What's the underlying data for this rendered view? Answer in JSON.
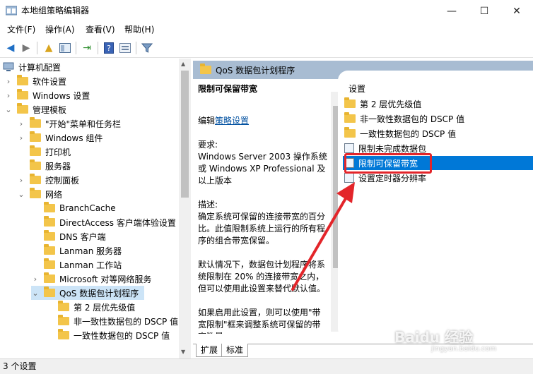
{
  "window": {
    "title": "本地组策略编辑器",
    "minimize_icon": "minimize-icon",
    "maximize_icon": "maximize-icon",
    "close_icon": "close-icon"
  },
  "menu": [
    "文件(F)",
    "操作(A)",
    "查看(V)",
    "帮助(H)"
  ],
  "toolbar": {
    "icons": [
      "back-arrow-icon",
      "forward-arrow-icon",
      "up-folder-icon",
      "show-hide-tree-icon",
      "export-icon",
      "help-icon",
      "properties-icon",
      "filter-icon"
    ]
  },
  "tree": {
    "root": "计算机配置",
    "items": [
      {
        "label": "软件设置"
      },
      {
        "label": "Windows 设置"
      },
      {
        "label": "管理模板"
      },
      {
        "label": "\"开始\"菜单和任务栏"
      },
      {
        "label": "Windows 组件"
      },
      {
        "label": "打印机"
      },
      {
        "label": "服务器"
      },
      {
        "label": "控制面板"
      },
      {
        "label": "网络"
      },
      {
        "label": "BranchCache"
      },
      {
        "label": "DirectAccess 客户端体验设置"
      },
      {
        "label": "DNS 客户端"
      },
      {
        "label": "Lanman 服务器"
      },
      {
        "label": "Lanman 工作站"
      },
      {
        "label": "Microsoft 对等网络服务"
      },
      {
        "label": "QoS 数据包计划程序"
      },
      {
        "label": "第 2 层优先级值"
      },
      {
        "label": "非一致性数据包的 DSCP 值"
      },
      {
        "label": "一致性数据包的 DSCP 值"
      }
    ]
  },
  "right": {
    "header": "QoS 数据包计划程序",
    "desc_title": "限制可保留带宽",
    "edit_prefix": "编辑",
    "edit_link": "策略设置",
    "req_label": "要求:",
    "req_text": "Windows Server 2003 操作系统或 Windows XP Professional 及以上版本",
    "desc_label": "描述:",
    "desc_text": "确定系统可保留的连接带宽的百分比。此值限制系统上运行的所有程序的组合带宽保留。",
    "default_text": "默认情况下，数据包计划程序将系统限制在 20% 的连接带宽之内，但可以使用此设置来替代默认值。",
    "enable_text": "如果启用此设置，则可以使用\"带宽限制\"框来调整系统可保留的带宽数量。",
    "settings_header": "设置",
    "settings": [
      {
        "label": "第 2 层优先级值",
        "type": "folder"
      },
      {
        "label": "非一致性数据包的 DSCP 值",
        "type": "folder"
      },
      {
        "label": "一致性数据包的 DSCP 值",
        "type": "folder"
      },
      {
        "label": "限制未完成数据包",
        "type": "setting"
      },
      {
        "label": "限制可保留带宽",
        "type": "setting"
      },
      {
        "label": "设置定时器分辨率",
        "type": "setting"
      }
    ]
  },
  "tabs": [
    "扩展",
    "标准"
  ],
  "status": "3 个设置",
  "watermark": {
    "main": "Baidu 经验",
    "sub": "jingyan.baidu.com"
  },
  "colors": {
    "selected": "#0078d7",
    "header": "#a8bcd2",
    "annotation": "#e3252a"
  }
}
